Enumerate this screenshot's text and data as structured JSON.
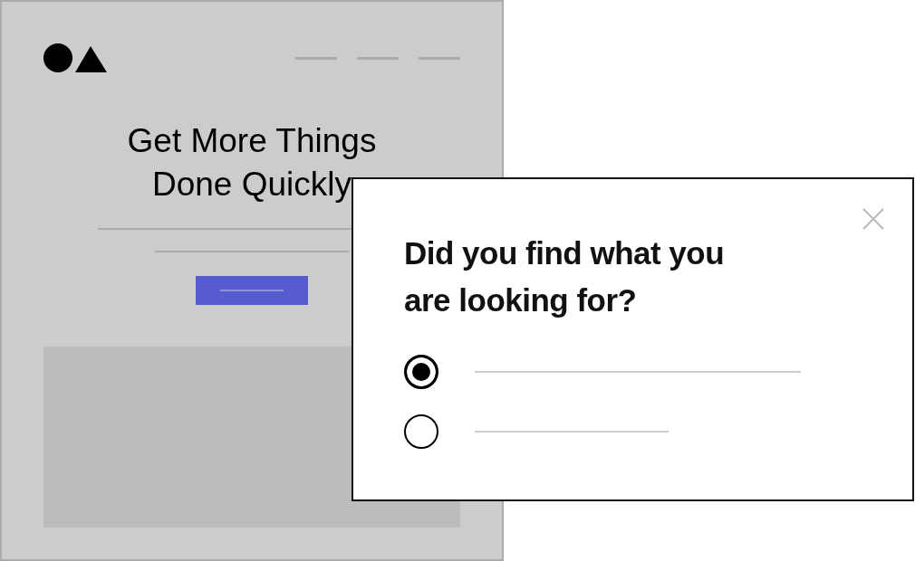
{
  "page": {
    "headline": "Get More Things Done Quickly"
  },
  "survey": {
    "question": "Did you find what you are looking for?",
    "options": [
      {
        "selected": true
      },
      {
        "selected": false
      }
    ]
  }
}
